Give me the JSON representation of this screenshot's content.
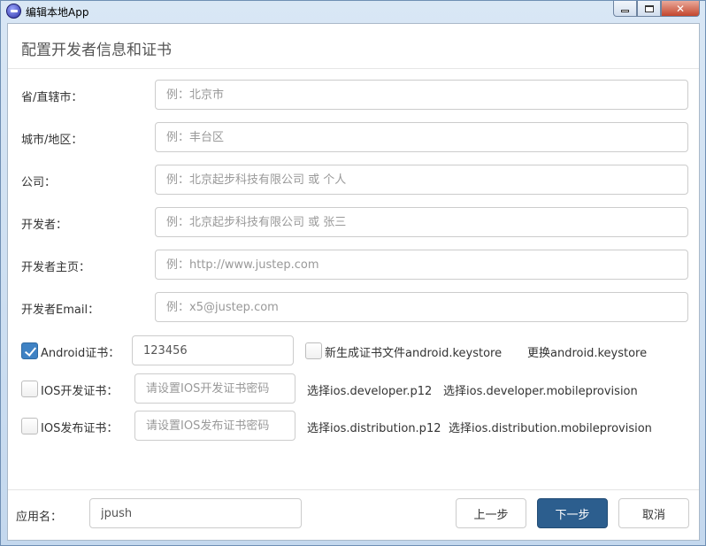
{
  "window": {
    "title": "编辑本地App",
    "close_glyph": "✕"
  },
  "page": {
    "title": "配置开发者信息和证书"
  },
  "fields": [
    {
      "label": "省/直辖市：",
      "placeholder": "例：北京市"
    },
    {
      "label": "城市/地区：",
      "placeholder": "例：丰台区"
    },
    {
      "label": "公司：",
      "placeholder": "例：北京起步科技有限公司 或 个人"
    },
    {
      "label": "开发者：",
      "placeholder": "例：北京起步科技有限公司 或 张三"
    },
    {
      "label": "开发者主页：",
      "placeholder": "例：http://www.justep.com"
    },
    {
      "label": "开发者Email：",
      "placeholder": "例：x5@justep.com"
    }
  ],
  "certs": {
    "android": {
      "checked": true,
      "label": "Android证书：",
      "password": "123456",
      "generate_label": "新生成证书文件android.keystore",
      "replace_label": "更换android.keystore"
    },
    "ios_dev": {
      "checked": false,
      "label": "IOS开发证书：",
      "placeholder": "请设置IOS开发证书密码",
      "p12_label": "选择ios.developer.p12",
      "provision_label": "选择ios.developer.mobileprovision"
    },
    "ios_dist": {
      "checked": false,
      "label": "IOS发布证书：",
      "placeholder": "请设置IOS发布证书密码",
      "p12_label": "选择ios.distribution.p12",
      "provision_label": "选择ios.distribution.mobileprovision"
    }
  },
  "footer": {
    "app_name_label": "应用名：",
    "app_name_value": "jpush",
    "prev_label": "上一步",
    "next_label": "下一步",
    "cancel_label": "取消"
  },
  "colors": {
    "primary": "#2c5e8e",
    "checkbox_checked": "#3f82c4"
  }
}
